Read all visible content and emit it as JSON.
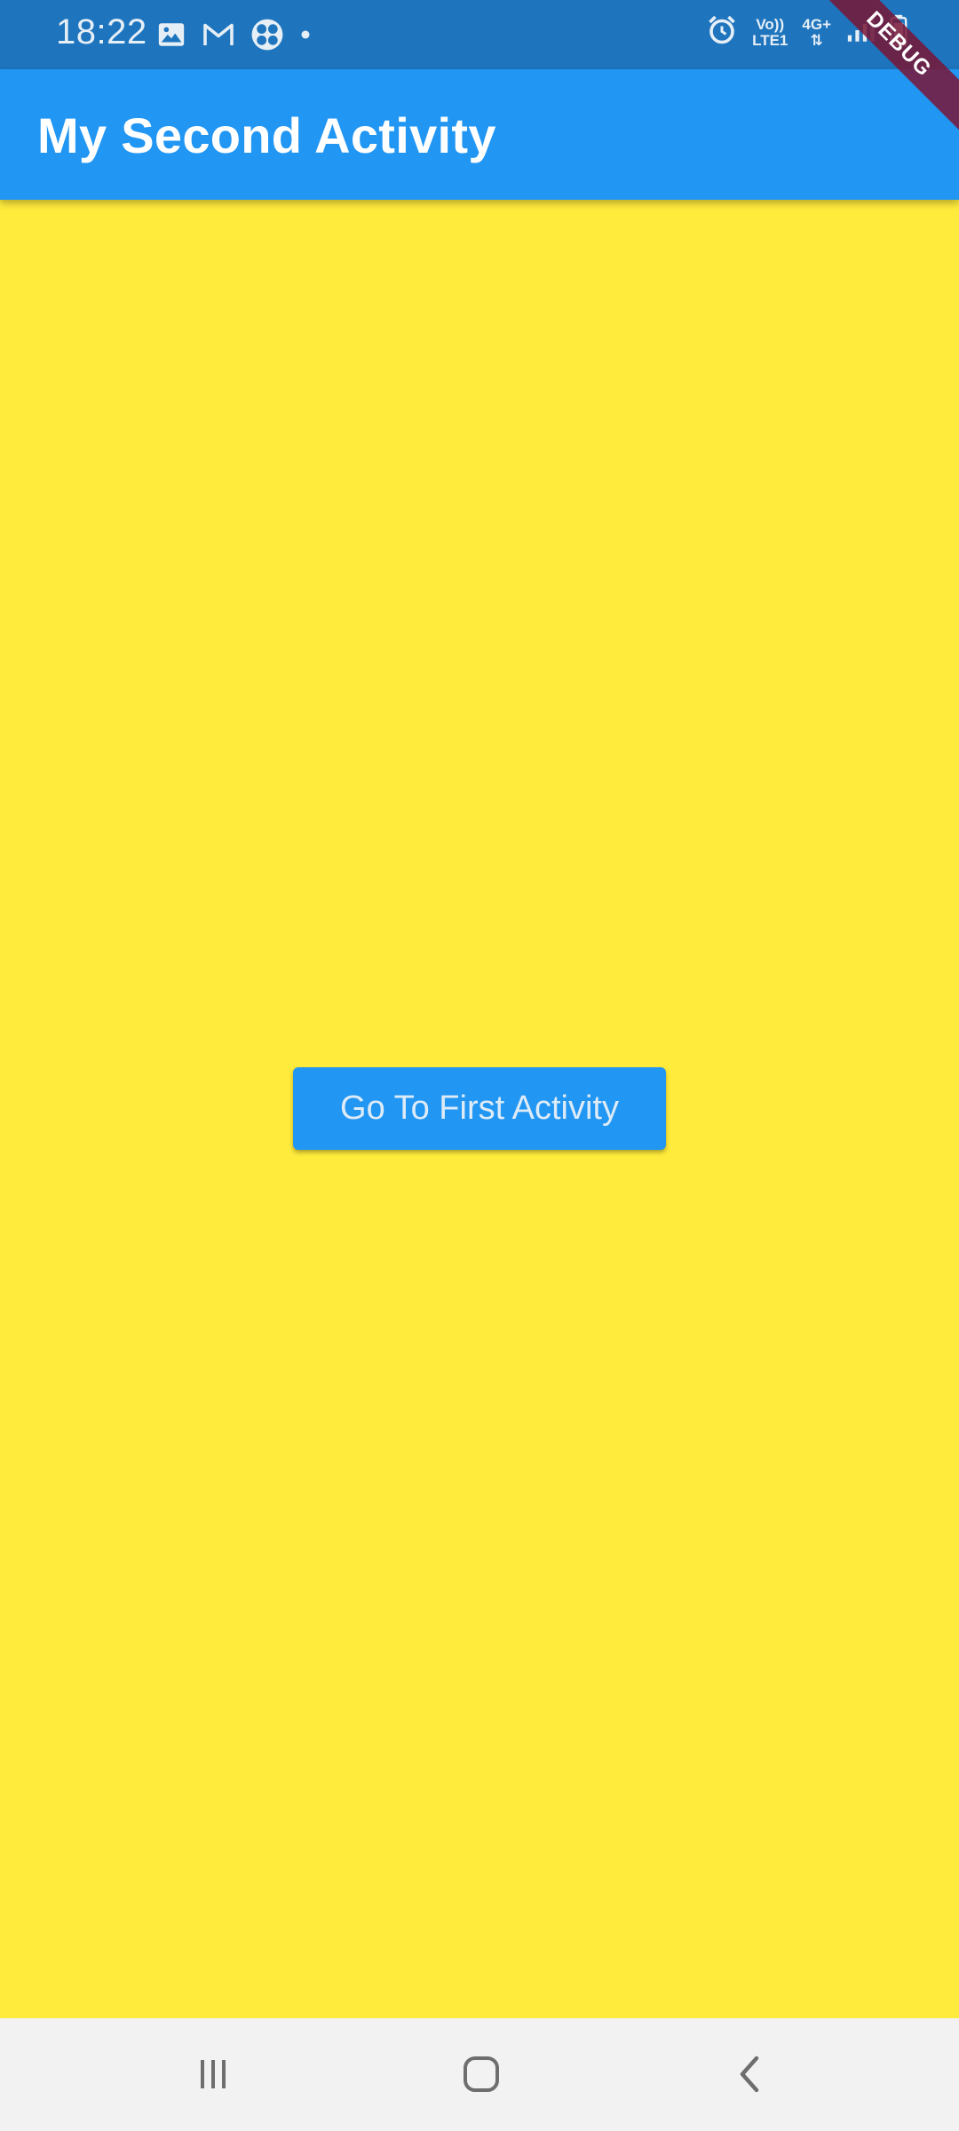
{
  "status_bar": {
    "time": "18:22",
    "network_top": "Vo))",
    "network_bottom": "LTE1",
    "network_type": "4G+",
    "icons": [
      "image-icon",
      "gmail-icon",
      "pinwheel-app-icon",
      "notification-dot-icon",
      "alarm-icon",
      "signal-icon",
      "battery-icon"
    ]
  },
  "app_bar": {
    "title": "My Second Activity",
    "color": "#2196F3"
  },
  "debug_banner": "DEBUG",
  "body": {
    "background_color": "#FFEB3B",
    "button_label": "Go To First Activity"
  },
  "nav_bar": {
    "items": [
      "recents-icon",
      "home-icon",
      "back-icon"
    ]
  }
}
